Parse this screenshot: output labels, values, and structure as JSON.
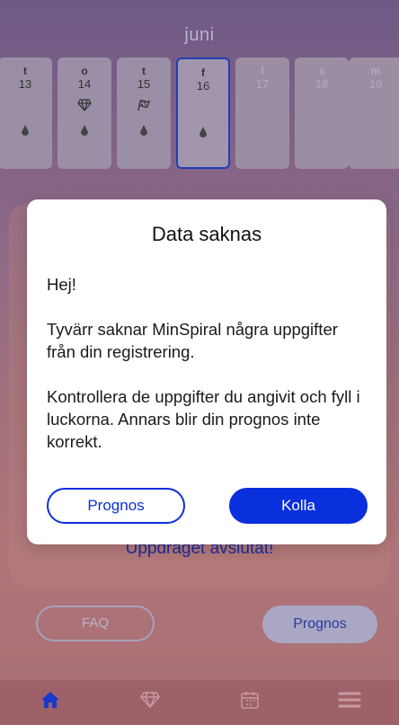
{
  "calendar": {
    "month": "juni",
    "days": [
      {
        "letter": "t",
        "num": "13",
        "icon1": "",
        "icon2": "💧",
        "faded": false,
        "selected": false
      },
      {
        "letter": "o",
        "num": "14",
        "icon1": "♢",
        "icon2": "💧",
        "faded": false,
        "selected": false
      },
      {
        "letter": "t",
        "num": "15",
        "icon1": "⚑",
        "icon2": "💧",
        "faded": false,
        "selected": false
      },
      {
        "letter": "f",
        "num": "16",
        "icon1": "",
        "icon2": "💧",
        "faded": false,
        "selected": true
      },
      {
        "letter": "l",
        "num": "17",
        "icon1": "",
        "icon2": "",
        "faded": true,
        "selected": false
      },
      {
        "letter": "s",
        "num": "18",
        "icon1": "",
        "icon2": "",
        "faded": true,
        "selected": false
      },
      {
        "letter": "m",
        "num": "19",
        "icon1": "",
        "icon2": "",
        "faded": true,
        "selected": false
      }
    ]
  },
  "background": {
    "mission_text": "Uppdraget avslutat!",
    "faq_label": "FAQ",
    "prognos_label": "Prognos"
  },
  "modal": {
    "title": "Data saknas",
    "greeting": "Hej!",
    "message1": "Tyvärr saknar MinSpiral några uppgifter från din registrering.",
    "message2": "Kontrollera de uppgifter du angivit och fyll i luckorna. Annars blir din prognos inte korrekt.",
    "secondary_button": "Prognos",
    "primary_button": "Kolla"
  },
  "nav": {
    "items": [
      {
        "icon": "home-icon",
        "glyph": "🏠",
        "active": true
      },
      {
        "icon": "diamond-icon",
        "glyph": "♢",
        "active": false
      },
      {
        "icon": "calendar-icon",
        "glyph": "▦",
        "active": false
      },
      {
        "icon": "menu-icon",
        "glyph": "☰",
        "active": false
      }
    ]
  }
}
